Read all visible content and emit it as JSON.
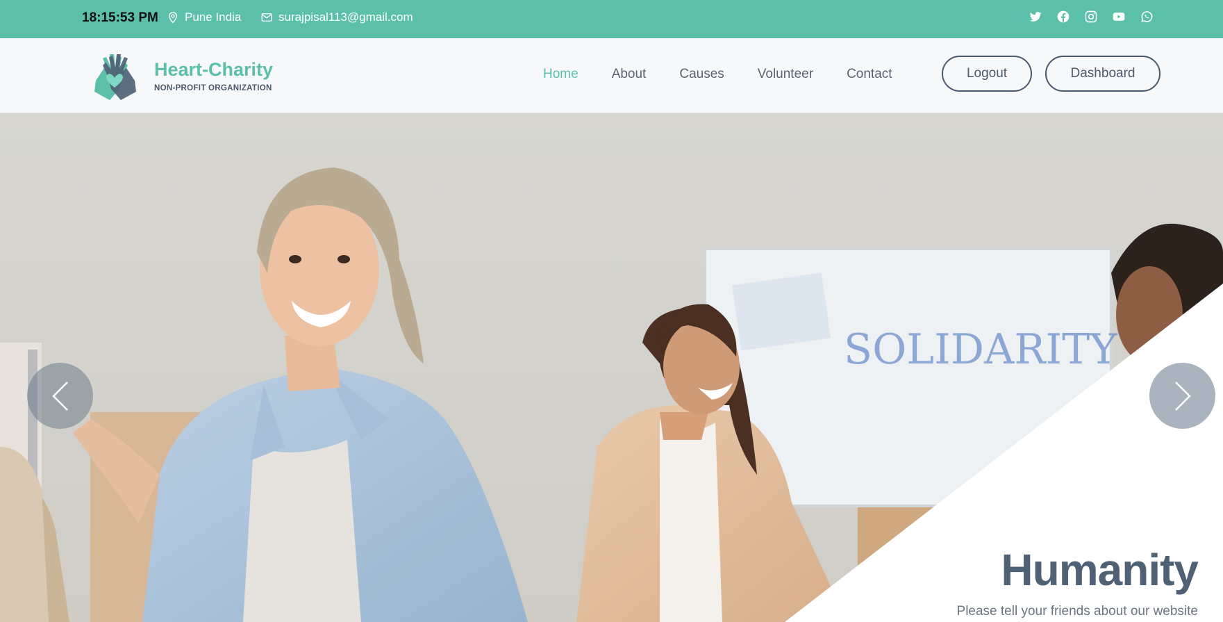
{
  "topbar": {
    "clock": "18:15:53 PM",
    "location": "Pune India",
    "email": "surajpisal113@gmail.com",
    "location_icon": "map-pin-icon",
    "email_icon": "envelope-icon",
    "socials": [
      "twitter-icon",
      "facebook-icon",
      "instagram-icon",
      "youtube-icon",
      "whatsapp-icon"
    ],
    "bg_color": "#5bbfaa"
  },
  "brand": {
    "name": "Heart-Charity",
    "tagline": "NON-PROFIT ORGANIZATION",
    "accent_color": "#5bbfaa",
    "dark_color": "#4f6275"
  },
  "nav": {
    "links": [
      "Home",
      "About",
      "Causes",
      "Volunteer",
      "Contact"
    ],
    "active": "Home",
    "logout_label": "Logout",
    "dashboard_label": "Dashboard"
  },
  "hero": {
    "title": "Humanity",
    "subtitle": "Please tell your friends about our website",
    "board_text": "SOLIDARITY",
    "prev_icon": "chevron-left-icon",
    "next_icon": "chevron-right-icon"
  }
}
